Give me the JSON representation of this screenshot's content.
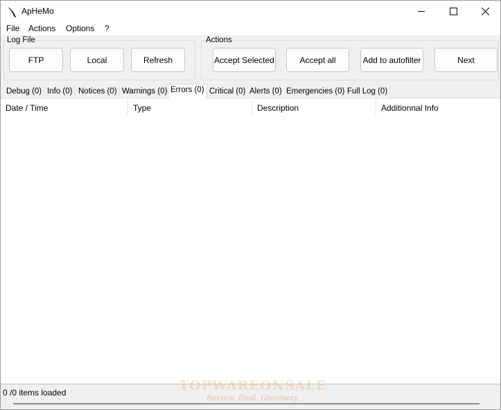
{
  "window": {
    "title": "ApHeMo",
    "icon": "feather-icon"
  },
  "menu": [
    "File",
    "Actions",
    "Options",
    "?"
  ],
  "log_file": {
    "title": "Log File",
    "buttons": [
      "FTP",
      "Local",
      "Refresh"
    ]
  },
  "actions": {
    "title": "Actions",
    "buttons": [
      "Accept Selected",
      "Accept all",
      "Add to autofilter",
      "Next"
    ]
  },
  "tabs": [
    {
      "label": "Debug (0)",
      "active": false
    },
    {
      "label": "Info (0)",
      "active": false
    },
    {
      "label": "Notices (0)",
      "active": false
    },
    {
      "label": "Warnings (0)",
      "active": false
    },
    {
      "label": "Errors (0)",
      "active": true
    },
    {
      "label": "Critical (0)",
      "active": false
    },
    {
      "label": "Alerts (0)",
      "active": false
    },
    {
      "label": "Emergencies (0)",
      "active": false
    },
    {
      "label": "Full Log (0)",
      "active": false
    }
  ],
  "columns": [
    "Date / Time",
    "Type",
    "Description",
    "Additionnal Info"
  ],
  "status": {
    "text": "0 /0 items loaded"
  },
  "watermark": {
    "title": "TOPWAREONSALE",
    "subtitle": "Review. Deal. Giveaway"
  }
}
